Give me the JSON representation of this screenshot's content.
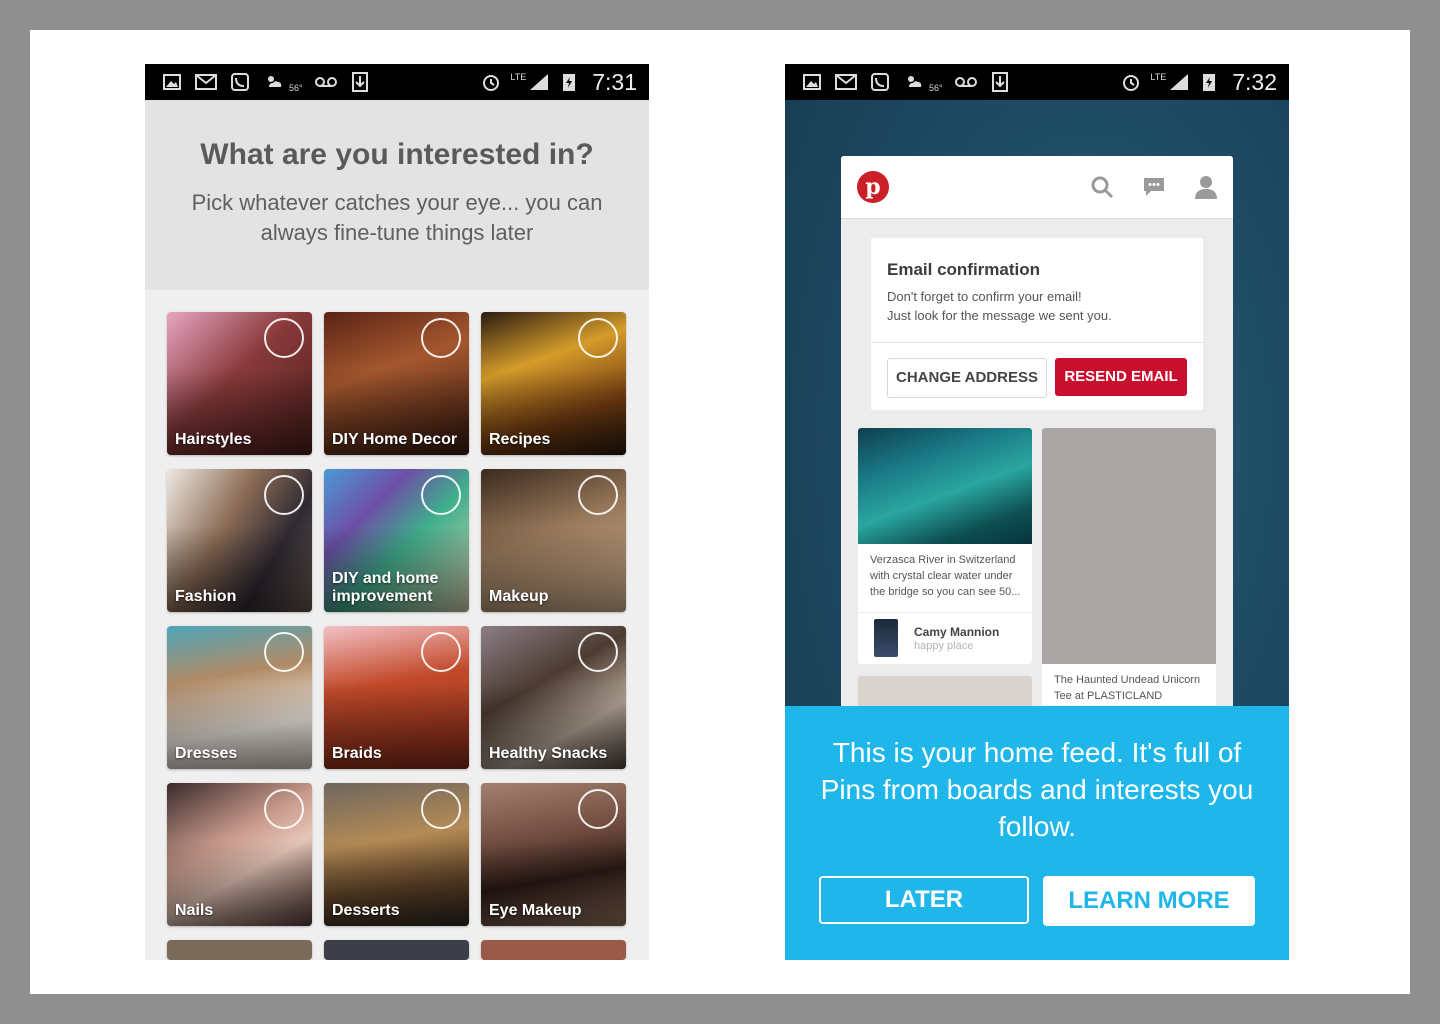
{
  "left_phone": {
    "status_bar": {
      "temperature": "56°",
      "network": "LTE",
      "time": "7:31"
    },
    "header": {
      "title": "What are you interested in?",
      "subtitle": "Pick whatever catches your eye... you can always fine-tune things later"
    },
    "tiles": [
      {
        "label": "Hairstyles"
      },
      {
        "label": "DIY Home Decor"
      },
      {
        "label": "Recipes"
      },
      {
        "label": "Fashion"
      },
      {
        "label": "DIY and home improvement"
      },
      {
        "label": "Makeup"
      },
      {
        "label": "Dresses"
      },
      {
        "label": "Braids"
      },
      {
        "label": "Healthy Snacks"
      },
      {
        "label": "Nails"
      },
      {
        "label": "Desserts"
      },
      {
        "label": "Eye Makeup"
      }
    ]
  },
  "right_phone": {
    "status_bar": {
      "temperature": "56°",
      "network": "LTE",
      "time": "7:32"
    },
    "app": {
      "logo_letter": "p",
      "email_card": {
        "title": "Email confirmation",
        "line1": "Don't forget to confirm your email!",
        "line2": "Just look for the message we sent you.",
        "change_label": "CHANGE ADDRESS",
        "resend_label": "RESEND EMAIL"
      },
      "pin1": {
        "description": "Verzasca River in Switzerland with crystal clear water under the bridge so you can see 50...",
        "user_name": "Camy Mannion",
        "board": "happy place"
      },
      "pin2": {
        "description": "The Haunted Undead Unicorn Tee at PLASTICLAND"
      }
    },
    "overlay": {
      "message": "This is your home feed. It's full of Pins from boards and interests you follow.",
      "later_label": "LATER",
      "learn_more_label": "LEARN MORE"
    }
  },
  "colors": {
    "pinterest_red": "#cb2027",
    "resend_red": "#c8102e",
    "overlay_blue": "#1fb7ea"
  }
}
